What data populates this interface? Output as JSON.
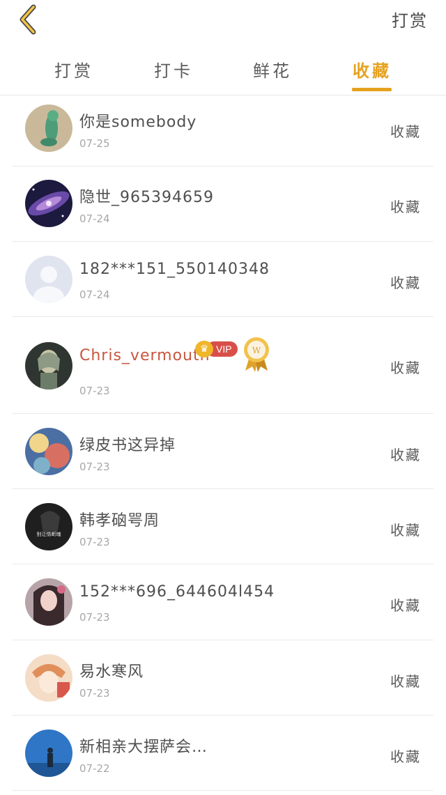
{
  "header": {
    "right_label": "打赏"
  },
  "tabs": [
    {
      "label": "打赏",
      "active": false
    },
    {
      "label": "打卡",
      "active": false
    },
    {
      "label": "鲜花",
      "active": false
    },
    {
      "label": "收藏",
      "active": true
    }
  ],
  "accent_color": "#e5a21f",
  "list": [
    {
      "name": "你是somebody",
      "date": "07-25",
      "action": "收藏",
      "avatar": "green-figure-avatar"
    },
    {
      "name": "隐世_965394659",
      "date": "07-24",
      "action": "收藏",
      "avatar": "galaxy-avatar"
    },
    {
      "name": "182***151_550140348",
      "date": "07-24",
      "action": "收藏",
      "avatar": "default-person-avatar"
    },
    {
      "name": "Chris_vermouth",
      "date": "07-23",
      "action": "收藏",
      "avatar": "anime-character-avatar",
      "badge": "VIP",
      "medal": "gold-medal-icon"
    },
    {
      "name": "绿皮书这异掉",
      "date": "07-23",
      "action": "收藏",
      "avatar": "colorful-art-avatar"
    },
    {
      "name": "韩孝硇咢周",
      "date": "07-23",
      "action": "收藏",
      "avatar": "dark-portrait-avatar",
      "avatar_text": "别让情断魂"
    },
    {
      "name": "152***696_644604l454",
      "date": "07-23",
      "action": "收藏",
      "avatar": "girl-portrait-avatar"
    },
    {
      "name": "易水寒风",
      "date": "07-23",
      "action": "收藏",
      "avatar": "anime-boy-avatar"
    },
    {
      "name": "新相亲大摆萨会…",
      "date": "07-22",
      "action": "收藏",
      "avatar": "blue-silhouette-avatar"
    }
  ]
}
